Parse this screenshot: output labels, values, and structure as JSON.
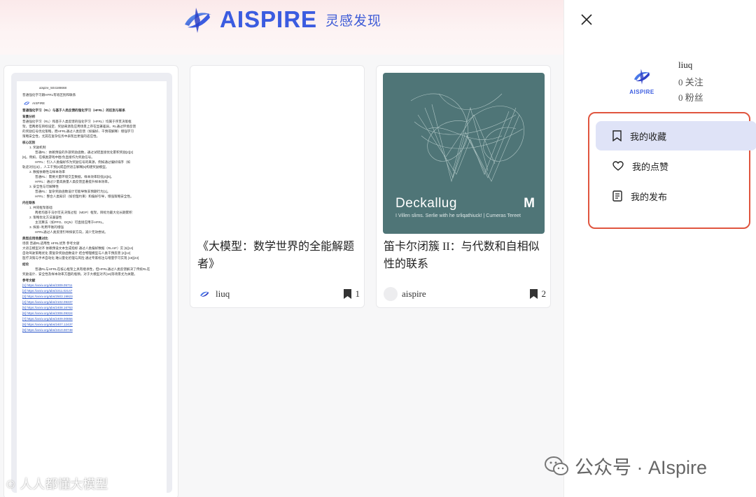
{
  "brand": {
    "logo_text": "AISPIRE",
    "logo_cn": "灵感发现"
  },
  "doc_card": {
    "id_line": "aispire_504188668",
    "subtitle": "普通强化学习跟HFRL有啥区别和联系",
    "logo_small": "AISPIRE",
    "heading": "普通强化学习（RL）与基于人类反馈的强化学习（HFRL）的区别与联系",
    "lines": [
      "背景分析",
      "普通强化学习（RL）和基于人类反馈的强化学习（HFRL）均属于序贯决策框",
      "架，但两者在目标设定、奖励来源及应用场景上存在显著差异。RL通过环境反馈",
      "的奖励信号优化策略，而HFRL通过人类反馈（如偏好、干预或解释）增强学习",
      "策略安全性，尤其在复杂任务中表现出更强的适应性。",
      "核心区别",
      "1. 奖励机制",
      "普通RL：依赖预设的外部奖励函数，通过试错直接优化累积奖励[2][2]",
      "[6]。例如，在棋类游戏中胜/负直接作为奖励信号。",
      "HFRL：引入人类偏好作为奖励信号的来源，例如通过偏好排序（如",
      "轨迹对比[3]），人工干预[3]或自然语言解释[5]构建奖励模型。",
      "2. 数据依赖性与样本效率",
      "普通RL：需要大量环境交互数据，样本效率较低[4][6]。",
      "HFRL：通过少量高质量人类反馈显著提升样本效率。",
      "3. 安全性与可解释性",
      "普通RL：复杂奖励函数设计可能导致非预期行为[1]。",
      "HFRL：整合人类知识（如伦理约束）和偏好引导，增强策略安全性。",
      "内在联系",
      "1. 共同框架基础",
      "两者均基于马尔可夫决策过程（MDP）框架，目标为最大化长期累积",
      "2. 策略优化方法兼容性",
      "主流算法（如PPO、DQN）可直接应用于HFRL。",
      "3. 探索–利用平衡的增强",
      "HFRL通过人类反馈引导探索方向，减少无效尝试。",
      "典型应用场景对比",
      "场景        普通RL适用性        HFRL优势        参考文献",
      "大语言模型对齐   依赖预设文本生成指标   通过人类偏好数据（RLAIF）实   [5][14]",
      "自动驾驶策略优化   需复杂奖励函数设计   结合物理模型与人类干预反馈   [2][12]",
      "医疗决策与手术自动化   难以量化伦理与风险   通过专家标注与增量学习实现   [19][23]",
      "结论",
      "普通RL与HFRL在核心框架上具有继承性，但HFRL通过人类反馈解决了传统RL在",
      "奖励设计、安全性及样本效率方面的瓶颈。对于大模型对齐[16]等场景尤为关键。",
      "参考文献"
    ],
    "refs": [
      "[1] https://arxiv.org/abs/2309.05711",
      "[2] https://arxiv.org/abs/2211.02147",
      "[3] https://arxiv.org/abs/2503.19923",
      "[4] https://arxiv.org/abs/2102.09337",
      "[5] https://arxiv.org/abs/2408.16763",
      "[6] https://arxiv.org/abs/2306.09324",
      "[7] https://arxiv.org/abs/2409.00856",
      "[8] https://arxiv.org/abs/2407.12437",
      "[9] https://arxiv.org/abs/2410.00748"
    ]
  },
  "cards": [
    {
      "title": "《大模型：数学世界的全能解题者》",
      "author": "liuq",
      "saves": "1"
    },
    {
      "title": "笛卡尔闭簇 II：与代数和自相似性的联系",
      "author": "aispire",
      "saves": "2",
      "cover_title": "Deckallug",
      "cover_letter": "M",
      "cover_sub": "I Villen slims. Serlie with he srliqathiuck! | Cumeras Tereet"
    }
  ],
  "user": {
    "name": "liuq",
    "follow": "0 关注",
    "fans": "0 粉丝"
  },
  "menu": [
    {
      "label": "我的收藏",
      "icon": "bookmark-icon",
      "active": true
    },
    {
      "label": "我的点赞",
      "icon": "heart-icon",
      "active": false
    },
    {
      "label": "我的发布",
      "icon": "document-icon",
      "active": false
    }
  ],
  "watermark": {
    "right": "公众号 · AIspire",
    "left": "人人都懂大模型"
  },
  "colors": {
    "accent": "#3b5ce0",
    "highlight_border": "#e0553f",
    "active_menu_bg": "#dfe3f7"
  }
}
